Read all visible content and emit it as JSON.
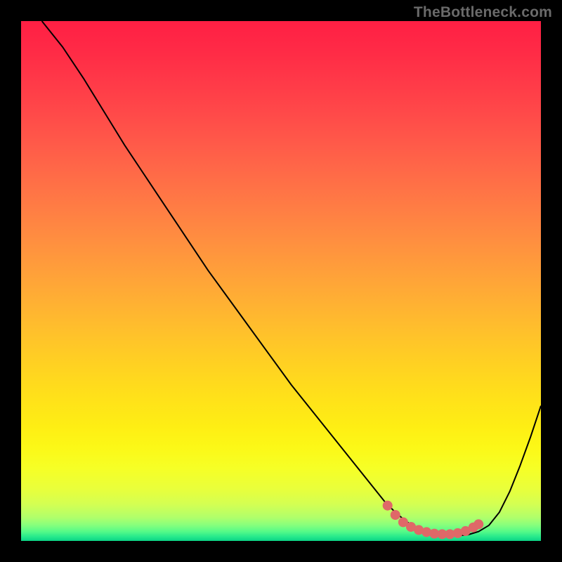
{
  "attribution": "TheBottleneck.com",
  "chart_data": {
    "type": "line",
    "title": "",
    "xlabel": "",
    "ylabel": "",
    "xlim": [
      0,
      100
    ],
    "ylim": [
      0,
      100
    ],
    "gradient_stops": [
      {
        "offset": 0.0,
        "color": "#ff1f44"
      },
      {
        "offset": 0.06,
        "color": "#ff2b46"
      },
      {
        "offset": 0.12,
        "color": "#ff3a48"
      },
      {
        "offset": 0.18,
        "color": "#ff4a49"
      },
      {
        "offset": 0.24,
        "color": "#ff5b49"
      },
      {
        "offset": 0.3,
        "color": "#ff6c47"
      },
      {
        "offset": 0.36,
        "color": "#ff7d44"
      },
      {
        "offset": 0.42,
        "color": "#ff8e40"
      },
      {
        "offset": 0.48,
        "color": "#ff9f3a"
      },
      {
        "offset": 0.54,
        "color": "#ffb033"
      },
      {
        "offset": 0.6,
        "color": "#ffc12b"
      },
      {
        "offset": 0.66,
        "color": "#ffd122"
      },
      {
        "offset": 0.72,
        "color": "#ffe01a"
      },
      {
        "offset": 0.78,
        "color": "#feee14"
      },
      {
        "offset": 0.82,
        "color": "#fcf817"
      },
      {
        "offset": 0.86,
        "color": "#f6ff26"
      },
      {
        "offset": 0.9,
        "color": "#e9ff3b"
      },
      {
        "offset": 0.93,
        "color": "#d3ff53"
      },
      {
        "offset": 0.955,
        "color": "#b0ff6b"
      },
      {
        "offset": 0.97,
        "color": "#85ff7d"
      },
      {
        "offset": 0.982,
        "color": "#55fa88"
      },
      {
        "offset": 0.992,
        "color": "#26e98c"
      },
      {
        "offset": 1.0,
        "color": "#0bd285"
      }
    ],
    "series": [
      {
        "name": "bottleneck-curve",
        "x": [
          4.0,
          8.0,
          12.0,
          16.0,
          20.0,
          24.0,
          28.0,
          32.0,
          36.0,
          40.0,
          44.0,
          48.0,
          52.0,
          56.0,
          60.0,
          64.0,
          68.0,
          70.0,
          72.0,
          74.0,
          76.0,
          78.0,
          80.0,
          82.0,
          84.0,
          86.0,
          88.0,
          90.0,
          92.0,
          94.0,
          96.0,
          98.0,
          100.0
        ],
        "y": [
          100.0,
          95.0,
          89.0,
          82.5,
          76.0,
          70.0,
          64.0,
          58.0,
          52.0,
          46.5,
          41.0,
          35.5,
          30.0,
          25.0,
          20.0,
          15.0,
          10.0,
          7.5,
          5.5,
          3.8,
          2.5,
          1.6,
          1.1,
          1.0,
          1.0,
          1.2,
          1.8,
          3.0,
          5.5,
          9.5,
          14.5,
          20.0,
          26.0
        ]
      }
    ],
    "trough_highlight": {
      "name": "trough-marker",
      "color": "#df6868",
      "x": [
        70.5,
        72.0,
        73.5,
        75.0,
        76.5,
        78.0,
        79.5,
        81.0,
        82.5,
        84.0,
        85.5,
        87.0,
        88.0
      ],
      "y": [
        6.8,
        5.0,
        3.6,
        2.7,
        2.1,
        1.7,
        1.4,
        1.3,
        1.3,
        1.5,
        1.9,
        2.6,
        3.2
      ]
    }
  }
}
